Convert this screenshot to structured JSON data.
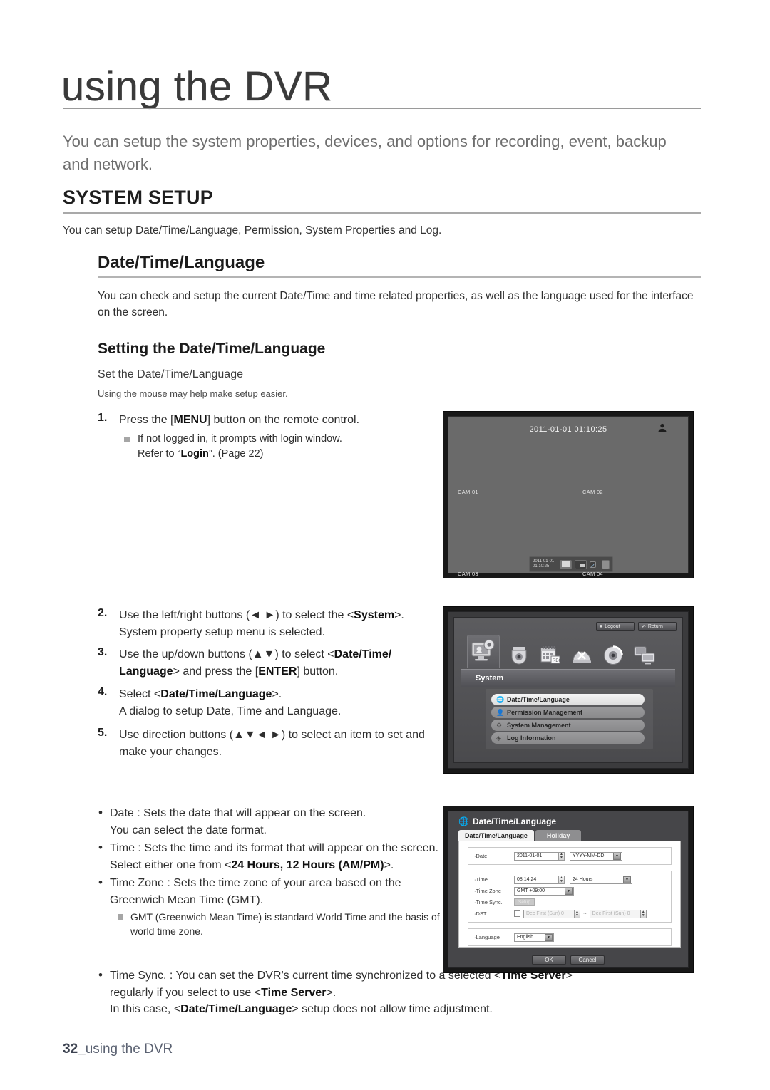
{
  "header": {
    "chapter_title": "using the DVR",
    "intro": "You can setup the system properties, devices, and options for recording, event, backup and network."
  },
  "section": {
    "title": "SYSTEM SETUP",
    "description": "You can setup Date/Time/Language, Permission, System Properties and Log.",
    "sub_title": "Date/Time/Language",
    "sub_description": "You can check and setup the current Date/Time and time related properties, as well as the language used for the interface on the screen.",
    "sub2_title": "Setting the Date/Time/Language",
    "lead1": "Set the Date/Time/Language",
    "lead2": "Using the mouse may help make setup easier."
  },
  "steps": [
    {
      "num": "1.",
      "text_html": "Press the [<b>MENU</b>] button on the remote control.",
      "note_html": "If not logged in, it prompts with login window.<br>Refer to “<b>Login</b>”. (Page 22)"
    },
    {
      "num": "2.",
      "text_html": "Use the left/right buttons (◄ ►) to select the &lt;<b>System</b>&gt;. System property setup menu is selected."
    },
    {
      "num": "3.",
      "text_html": "Use the up/down buttons (▲▼) to select &lt;<b>Date/Time/ Language</b>&gt; and press the [<b>ENTER</b>] button."
    },
    {
      "num": "4.",
      "text_html": "Select &lt;<b>Date/Time/Language</b>&gt;.<br>A dialog to setup Date, Time and Language."
    },
    {
      "num": "5.",
      "text_html": "Use direction buttons (▲▼◄ ►) to select an item to set and make your changes."
    }
  ],
  "bullets": [
    {
      "text_html": "Date : Sets the date that will appear on the screen.<br>You can select the date format."
    },
    {
      "text_html": "Time : Sets the time and its format that will appear on the screen.<br>Select either one from &lt;<b>24 Hours, 12 Hours (AM/PM)</b>&gt;."
    },
    {
      "text_html": "Time Zone : Sets the time zone of your area based on the Greenwich Mean Time (GMT).",
      "note_html": "GMT (Greenwich Mean Time) is standard World Time and the basis of world time zone."
    }
  ],
  "time_sync": {
    "text_html": "Time Sync. : You can set the DVR’s current time synchronized to a selected &lt;<b>Time Server</b>&gt; regularly if you select to use &lt;<b>Time Server</b>&gt;.<br>In this case, &lt;<b>Date/Time/Language</b>&gt; setup does not allow time adjustment."
  },
  "footer": {
    "page": "32_",
    "label": "using the DVR"
  },
  "shot_live": {
    "datetime": "2011-01-01 01:10:25",
    "user_icon": "user-icon",
    "cameras": [
      "CAM 01",
      "CAM 02",
      "CAM 03",
      "CAM 04"
    ],
    "bar_date": "2011-01-01",
    "bar_time": "01:10:25",
    "bar_buttons": [
      "quad-split-icon",
      "pip-icon",
      "check-icon",
      "square-icon"
    ]
  },
  "shot_menu": {
    "logout_label": "Logout",
    "return_label": "Return",
    "logout_icon": "power-icon",
    "return_icon": "return-arrow-icon",
    "tab_icons": [
      "system-icon",
      "camera-icon",
      "record-icon",
      "event-icon",
      "backup-icon",
      "network-icon"
    ],
    "section_title": "System",
    "items": [
      {
        "label": "Date/Time/Language",
        "icon": "globe-icon",
        "active": true
      },
      {
        "label": "Permission Management",
        "icon": "person-icon",
        "active": false
      },
      {
        "label": "System Management",
        "icon": "gear-icon",
        "active": false
      },
      {
        "label": "Log Information",
        "icon": "diamond-icon",
        "active": false
      }
    ]
  },
  "shot_dialog": {
    "title": "Date/Time/Language",
    "title_icon": "globe-icon",
    "tabs": [
      {
        "label": "Date/Time/Language",
        "active": true
      },
      {
        "label": "Holiday",
        "active": false
      }
    ],
    "fields": {
      "date_label": "Date",
      "date_value": "2011-01-01",
      "date_format": "YYYY-MM-DD",
      "time_label": "Time",
      "time_value": "08:14:24",
      "time_format": "24 Hours",
      "timezone_label": "Time Zone",
      "timezone_value": "GMT +09:00",
      "timesync_label": "Time Sync.",
      "timesync_button": "Setup",
      "dst_label": "DST",
      "dst_from": "Dec First (Sun) 0",
      "dst_to": "Dec First (Sun) 0",
      "dst_sep": "~",
      "language_label": "Language",
      "language_value": "English"
    },
    "ok_label": "OK",
    "cancel_label": "Cancel"
  }
}
